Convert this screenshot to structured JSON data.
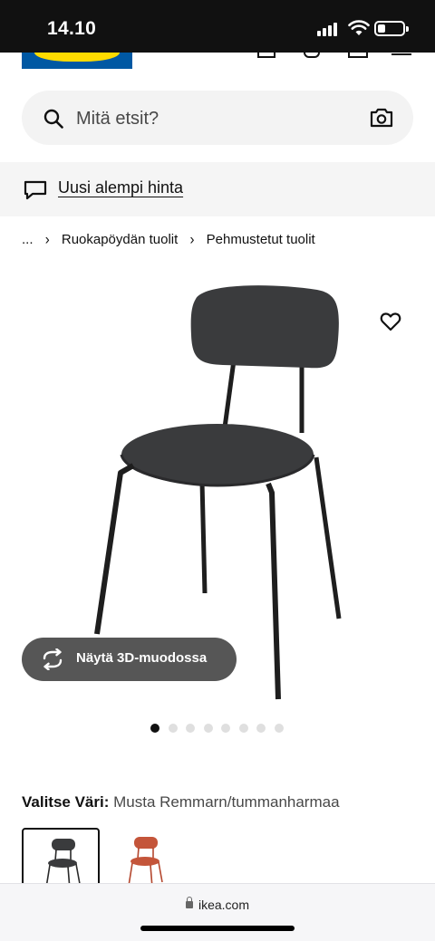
{
  "status_bar": {
    "time": "14.10"
  },
  "search": {
    "placeholder": "Mitä etsit?"
  },
  "banner": {
    "link_text": "Uusi alempi hinta"
  },
  "breadcrumb": {
    "items": [
      "...",
      "Ruokapöydän tuolit",
      "Pehmustetut tuolit"
    ]
  },
  "product": {
    "view_3d_label": "Näytä 3D-muodossa",
    "image_count": 8,
    "active_image_index": 0
  },
  "color_selector": {
    "title": "Valitse Väri:",
    "selected_value": "Musta Remmarn/tummanharmaa",
    "swatches": [
      {
        "name": "black",
        "color": "#3a3a3a",
        "selected": true
      },
      {
        "name": "red-orange",
        "color": "#c4553a",
        "selected": false
      }
    ]
  },
  "browser": {
    "url": "ikea.com"
  },
  "colors": {
    "ikea_blue": "#0058a3",
    "ikea_yellow": "#ffdb00",
    "overlay_button": "#484848"
  }
}
